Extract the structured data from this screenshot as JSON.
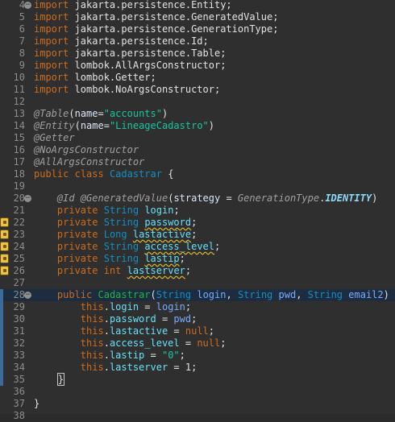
{
  "editor": {
    "lines": [
      {
        "n": "4",
        "fold": true,
        "tokens": [
          [
            "kw",
            "import"
          ],
          [
            "plain",
            " jakarta.persistence.Entity;"
          ]
        ]
      },
      {
        "n": "5",
        "tokens": [
          [
            "kw",
            "import"
          ],
          [
            "plain",
            " jakarta.persistence.GeneratedValue;"
          ]
        ]
      },
      {
        "n": "6",
        "tokens": [
          [
            "kw",
            "import"
          ],
          [
            "plain",
            " jakarta.persistence.GenerationType;"
          ]
        ]
      },
      {
        "n": "7",
        "tokens": [
          [
            "kw",
            "import"
          ],
          [
            "plain",
            " jakarta.persistence.Id;"
          ]
        ]
      },
      {
        "n": "8",
        "tokens": [
          [
            "kw",
            "import"
          ],
          [
            "plain",
            " jakarta.persistence.Table;"
          ]
        ]
      },
      {
        "n": "9",
        "tokens": [
          [
            "kw",
            "import"
          ],
          [
            "plain",
            " lombok.AllArgsConstructor;"
          ]
        ]
      },
      {
        "n": "10",
        "tokens": [
          [
            "kw",
            "import"
          ],
          [
            "plain",
            " lombok.Getter;"
          ]
        ]
      },
      {
        "n": "11",
        "tokens": [
          [
            "kw",
            "import"
          ],
          [
            "plain",
            " lombok.NoArgsConstructor;"
          ]
        ]
      },
      {
        "n": "12",
        "tokens": []
      },
      {
        "n": "13",
        "tokens": [
          [
            "ann",
            "@Table"
          ],
          [
            "plain",
            "("
          ],
          [
            "attr",
            "name"
          ],
          [
            "plain",
            "="
          ],
          [
            "str",
            "\"accounts\""
          ],
          [
            "plain",
            ")"
          ]
        ]
      },
      {
        "n": "14",
        "tokens": [
          [
            "ann",
            "@Entity"
          ],
          [
            "plain",
            "("
          ],
          [
            "attr",
            "name"
          ],
          [
            "plain",
            "="
          ],
          [
            "str",
            "\"LineageCadastro\""
          ],
          [
            "plain",
            ")"
          ]
        ]
      },
      {
        "n": "15",
        "tokens": [
          [
            "ann",
            "@Getter"
          ]
        ]
      },
      {
        "n": "16",
        "tokens": [
          [
            "ann",
            "@NoArgsConstructor"
          ]
        ]
      },
      {
        "n": "17",
        "tokens": [
          [
            "ann",
            "@AllArgsConstructor"
          ]
        ]
      },
      {
        "n": "18",
        "tokens": [
          [
            "kw",
            "public"
          ],
          [
            "plain",
            " "
          ],
          [
            "kw",
            "class"
          ],
          [
            "plain",
            " "
          ],
          [
            "cls",
            "Cadastrar"
          ],
          [
            "plain",
            " {"
          ]
        ]
      },
      {
        "n": "19",
        "tokens": []
      },
      {
        "n": "20",
        "fold": true,
        "tokens": [
          [
            "plain",
            "    "
          ],
          [
            "ann",
            "@Id"
          ],
          [
            "plain",
            " "
          ],
          [
            "ann",
            "@GeneratedValue"
          ],
          [
            "plain",
            "("
          ],
          [
            "attr",
            "strategy"
          ],
          [
            "plain",
            " = "
          ],
          [
            "ann",
            "GenerationType"
          ],
          [
            "plain",
            "."
          ],
          [
            "sfield",
            "IDENTITY"
          ],
          [
            "plain",
            ")"
          ]
        ]
      },
      {
        "n": "21",
        "tokens": [
          [
            "plain",
            "    "
          ],
          [
            "kw",
            "private"
          ],
          [
            "plain",
            " "
          ],
          [
            "type",
            "String"
          ],
          [
            "plain",
            " "
          ],
          [
            "field",
            "login"
          ],
          [
            "plain",
            ";"
          ]
        ]
      },
      {
        "n": "22",
        "marker": true,
        "tokens": [
          [
            "plain",
            "    "
          ],
          [
            "kw",
            "private"
          ],
          [
            "plain",
            " "
          ],
          [
            "type",
            "String"
          ],
          [
            "plain",
            " "
          ],
          [
            "field warn",
            "password"
          ],
          [
            "plain",
            ";"
          ]
        ]
      },
      {
        "n": "23",
        "marker": true,
        "tokens": [
          [
            "plain",
            "    "
          ],
          [
            "kw",
            "private"
          ],
          [
            "plain",
            " "
          ],
          [
            "type",
            "Long"
          ],
          [
            "plain",
            " "
          ],
          [
            "field warn",
            "lastactive"
          ],
          [
            "plain",
            ";"
          ]
        ]
      },
      {
        "n": "24",
        "marker": true,
        "tokens": [
          [
            "plain",
            "    "
          ],
          [
            "kw",
            "private"
          ],
          [
            "plain",
            " "
          ],
          [
            "type",
            "String"
          ],
          [
            "plain",
            " "
          ],
          [
            "field warn",
            "access_level"
          ],
          [
            "plain",
            ";"
          ]
        ]
      },
      {
        "n": "25",
        "marker": true,
        "tokens": [
          [
            "plain",
            "    "
          ],
          [
            "kw",
            "private"
          ],
          [
            "plain",
            " "
          ],
          [
            "type",
            "String"
          ],
          [
            "plain",
            " "
          ],
          [
            "field warn",
            "lastip"
          ],
          [
            "plain",
            ";"
          ]
        ]
      },
      {
        "n": "26",
        "marker": true,
        "tokens": [
          [
            "plain",
            "    "
          ],
          [
            "kw",
            "private"
          ],
          [
            "plain",
            " "
          ],
          [
            "kw",
            "int"
          ],
          [
            "plain",
            " "
          ],
          [
            "field warn",
            "lastserver"
          ],
          [
            "plain",
            ";"
          ]
        ]
      },
      {
        "n": "27",
        "tokens": []
      },
      {
        "n": "28",
        "fold": true,
        "current": true,
        "modified": true,
        "tokens": [
          [
            "plain",
            "    "
          ],
          [
            "kw",
            "public"
          ],
          [
            "plain",
            " "
          ],
          [
            "ctor",
            "Cadastrar"
          ],
          [
            "plain",
            "("
          ],
          [
            "type",
            "String"
          ],
          [
            "plain",
            " "
          ],
          [
            "param",
            "login"
          ],
          [
            "plain",
            ", "
          ],
          [
            "type",
            "String"
          ],
          [
            "plain",
            " "
          ],
          [
            "param",
            "pwd"
          ],
          [
            "plain",
            ", "
          ],
          [
            "type",
            "String"
          ],
          [
            "plain",
            " "
          ],
          [
            "param",
            "email2"
          ],
          [
            "plain",
            ") {"
          ],
          [
            "caret",
            ""
          ]
        ]
      },
      {
        "n": "29",
        "modified": true,
        "tokens": [
          [
            "plain",
            "        "
          ],
          [
            "kw",
            "this"
          ],
          [
            "plain",
            "."
          ],
          [
            "field",
            "login"
          ],
          [
            "plain",
            " = "
          ],
          [
            "param",
            "login"
          ],
          [
            "plain",
            ";"
          ]
        ]
      },
      {
        "n": "30",
        "modified": true,
        "tokens": [
          [
            "plain",
            "        "
          ],
          [
            "kw",
            "this"
          ],
          [
            "plain",
            "."
          ],
          [
            "field",
            "password"
          ],
          [
            "plain",
            " = "
          ],
          [
            "param",
            "pwd"
          ],
          [
            "plain",
            ";"
          ]
        ]
      },
      {
        "n": "31",
        "modified": true,
        "tokens": [
          [
            "plain",
            "        "
          ],
          [
            "kw",
            "this"
          ],
          [
            "plain",
            "."
          ],
          [
            "field",
            "lastactive"
          ],
          [
            "plain",
            " = "
          ],
          [
            "kw",
            "null"
          ],
          [
            "plain",
            ";"
          ]
        ]
      },
      {
        "n": "32",
        "modified": true,
        "tokens": [
          [
            "plain",
            "        "
          ],
          [
            "kw",
            "this"
          ],
          [
            "plain",
            "."
          ],
          [
            "field",
            "access_level"
          ],
          [
            "plain",
            " = "
          ],
          [
            "kw",
            "null"
          ],
          [
            "plain",
            ";"
          ]
        ]
      },
      {
        "n": "33",
        "modified": true,
        "tokens": [
          [
            "plain",
            "        "
          ],
          [
            "kw",
            "this"
          ],
          [
            "plain",
            "."
          ],
          [
            "field",
            "lastip"
          ],
          [
            "plain",
            " = "
          ],
          [
            "str",
            "\"0\""
          ],
          [
            "plain",
            ";"
          ]
        ]
      },
      {
        "n": "34",
        "modified": true,
        "tokens": [
          [
            "plain",
            "        "
          ],
          [
            "kw",
            "this"
          ],
          [
            "plain",
            "."
          ],
          [
            "field",
            "lastserver"
          ],
          [
            "plain",
            " = 1;"
          ]
        ]
      },
      {
        "n": "35",
        "modified": true,
        "tokens": [
          [
            "plain",
            "    "
          ],
          [
            "brace",
            "}"
          ]
        ]
      },
      {
        "n": "36",
        "tokens": []
      },
      {
        "n": "37",
        "tokens": [
          [
            "plain",
            "}"
          ]
        ]
      },
      {
        "n": "38",
        "tokens": []
      }
    ]
  }
}
